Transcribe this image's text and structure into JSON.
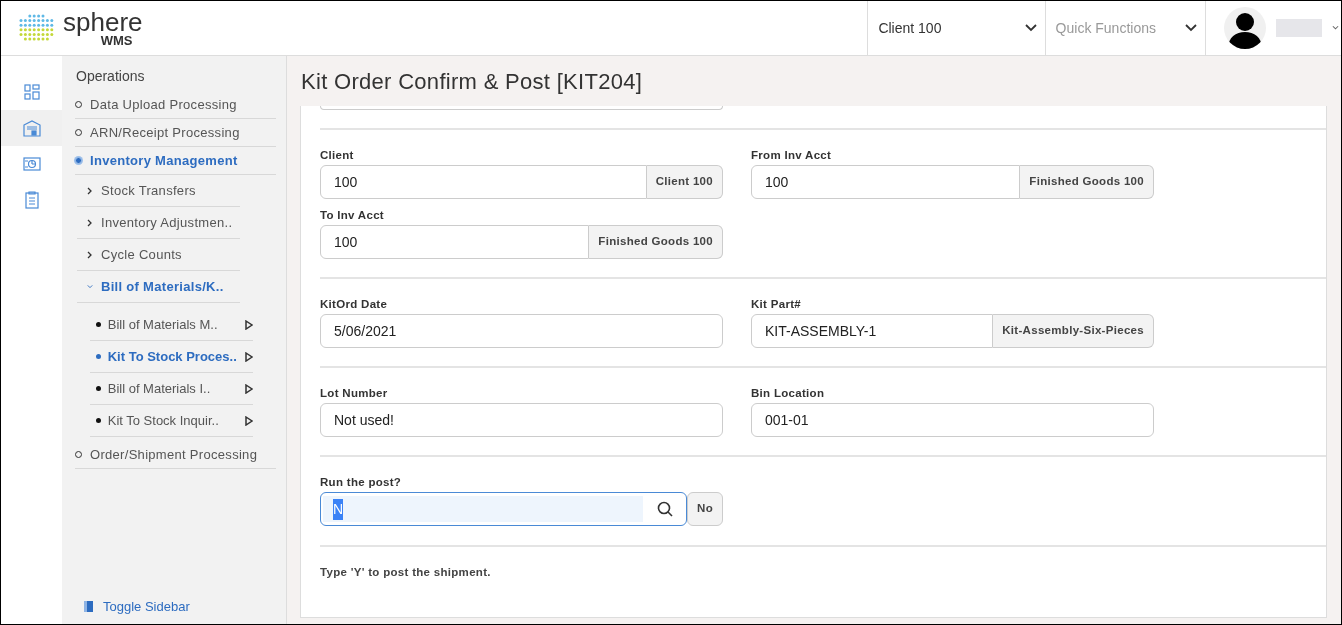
{
  "header": {
    "logo": {
      "name": "sphere",
      "sub": "WMS"
    },
    "client_select": {
      "value": "Client 100"
    },
    "quick_functions": {
      "placeholder": "Quick Functions"
    }
  },
  "rail": [
    {
      "kind": "dashboard",
      "selected": false
    },
    {
      "kind": "warehouse",
      "selected": true
    },
    {
      "kind": "report",
      "selected": false
    },
    {
      "kind": "clipboard",
      "selected": false
    }
  ],
  "sidebar": {
    "heading": "Operations",
    "items": [
      {
        "label": "Data Upload Processing",
        "selected": false
      },
      {
        "label": "ARN/Receipt Processing",
        "selected": false
      },
      {
        "label": "Inventory Management",
        "selected": true,
        "children": [
          {
            "label": "Stock Transfers",
            "expanded": false
          },
          {
            "label": "Inventory Adjustmen..",
            "expanded": false
          },
          {
            "label": "Cycle Counts",
            "expanded": false
          },
          {
            "label": "Bill of Materials/K..",
            "expanded": true,
            "children": [
              {
                "label": "Bill of Materials M..",
                "selected": false
              },
              {
                "label": "Kit To Stock Proces..",
                "selected": true
              },
              {
                "label": "Bill of Materials I..",
                "selected": false
              },
              {
                "label": "Kit To Stock Inquir..",
                "selected": false
              }
            ]
          }
        ]
      },
      {
        "label": "Order/Shipment Processing",
        "selected": false
      }
    ],
    "toggle": "Toggle Sidebar"
  },
  "page": {
    "title": "Kit Order Confirm & Post [KIT204]",
    "sections": [
      [
        {
          "label": "Client",
          "value": "100",
          "addon": "Client 100",
          "kind": "text",
          "focused": false
        },
        {
          "label": "From Inv Acct",
          "value": "100",
          "addon": "Finished Goods 100",
          "kind": "text",
          "focused": false
        },
        {
          "label": "To Inv Acct",
          "value": "100",
          "addon": "Finished Goods 100",
          "kind": "text",
          "focused": false
        }
      ],
      [
        {
          "label": "KitOrd Date",
          "value": "5/06/2021",
          "kind": "text",
          "focused": false
        },
        {
          "label": "Kit Part#",
          "value": "KIT-ASSEMBLY-1",
          "addon": "Kit-Assembly-Six-Pieces",
          "kind": "text",
          "focused": false
        }
      ],
      [
        {
          "label": "Lot Number",
          "value": "Not used!",
          "kind": "text",
          "focused": false
        },
        {
          "label": "Bin Location",
          "value": "001-01",
          "kind": "text",
          "focused": false
        }
      ],
      [
        {
          "label": "Run the post?",
          "value": "N",
          "addon": "No",
          "kind": "lookup",
          "focused": true
        }
      ]
    ],
    "hint": "Type 'Y' to post the shipment."
  }
}
